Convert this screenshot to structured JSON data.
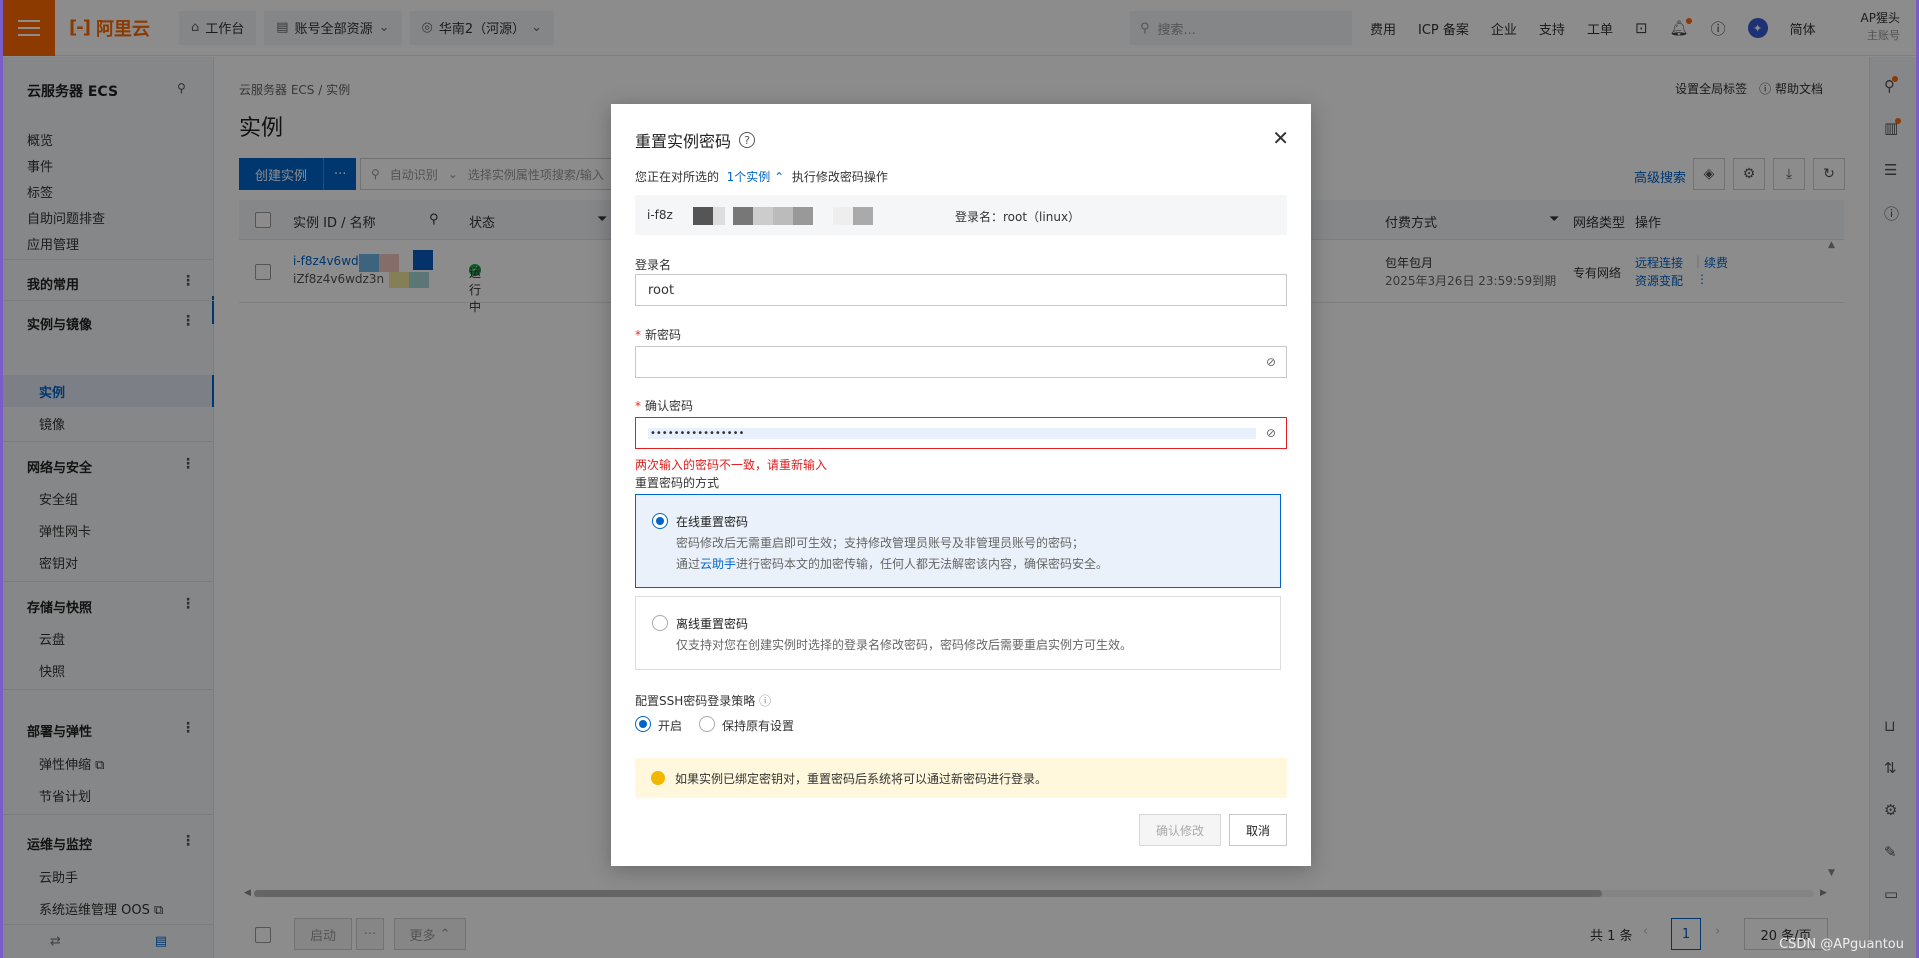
{
  "topbar": {
    "logo_text": "阿里云",
    "workbench": "工作台",
    "resources": "账号全部资源",
    "region": "华南2（河源）",
    "search_placeholder": "搜索...",
    "links": [
      "费用",
      "ICP 备案",
      "企业",
      "支持",
      "工单"
    ],
    "lang": "简体",
    "user_name": "AP猩头",
    "user_sub": "主账号"
  },
  "sidebar": {
    "title": "云服务器 ECS",
    "items": [
      "概览",
      "事件",
      "标签",
      "自助问题排查",
      "应用管理"
    ],
    "favorites": "我的常用",
    "group_instances": "实例与镜像",
    "instances": "实例",
    "images": "镜像",
    "group_network": "网络与安全",
    "network_items": [
      "安全组",
      "弹性网卡",
      "密钥对"
    ],
    "group_storage": "存储与快照",
    "storage_items": [
      "云盘",
      "快照"
    ],
    "group_deploy": "部署与弹性",
    "deploy_items": [
      "弹性伸缩",
      "节省计划"
    ],
    "group_ops": "运维与监控",
    "ops_items": [
      "云助手",
      "系统运维管理 OOS"
    ]
  },
  "main": {
    "breadcrumb": "云服务器 ECS / 实例",
    "title": "实例",
    "global_tags": "设置全局标签",
    "help_docs": "帮助文档",
    "create_btn": "创建实例",
    "more_btn": "···",
    "filter_mode": "自动识别",
    "filter_placeholder": "选择实例属性项搜索/输入",
    "advanced_search": "高级搜索",
    "columns": {
      "id_name": "实例 ID / 名称",
      "status": "状态",
      "billing": "付费方式",
      "network": "网络类型",
      "actions": "操作"
    },
    "row": {
      "id": "i-f8z4v6wd",
      "name": "iZf8z4v6wdz3n",
      "status": "运行中",
      "billing": "包年包月",
      "expiry": "2025年3月26日 23:59:59到期",
      "network": "专有网络",
      "action_remote": "远程连接",
      "action_renew": "续费",
      "action_resize": "资源变配"
    },
    "footer": {
      "start": "启动",
      "more": "更多",
      "total": "共 1 条",
      "page": "1",
      "per_page": "20 条/页"
    }
  },
  "modal": {
    "title": "重置实例密码",
    "intro_prefix": "您正在对所选的",
    "intro_link": "1个实例",
    "intro_suffix": "执行修改密码操作",
    "instance_id": "i-f8z",
    "login_info": "登录名：root（linux）",
    "login_label": "登录名",
    "login_value": "root",
    "new_pwd_label": "新密码",
    "confirm_pwd_label": "确认密码",
    "confirm_pwd_value": "••••••••••••••••",
    "error_msg": "两次输入的密码不一致，请重新输入",
    "method_label": "重置密码的方式",
    "online_title": "在线重置密码",
    "online_desc1": "密码修改后无需重启即可生效；支持修改管理员账号及非管理员账号的密码；",
    "online_desc2_prefix": "通过",
    "online_desc2_link": "云助手",
    "online_desc2_suffix": "进行密码本文的加密传输，任何人都无法解密该内容，确保密码安全。",
    "offline_title": "离线重置密码",
    "offline_desc": "仅支持对您在创建实例时选择的登录名修改密码，密码修改后需要重启实例方可生效。",
    "ssh_label": "配置SSH密码登录策略",
    "ssh_on": "开启",
    "ssh_keep": "保持原有设置",
    "notice": "如果实例已绑定密钥对，重置密码后系统将可以通过新密码进行登录。",
    "confirm_btn": "确认修改",
    "cancel_btn": "取消"
  },
  "watermark": "CSDN @APguantou"
}
